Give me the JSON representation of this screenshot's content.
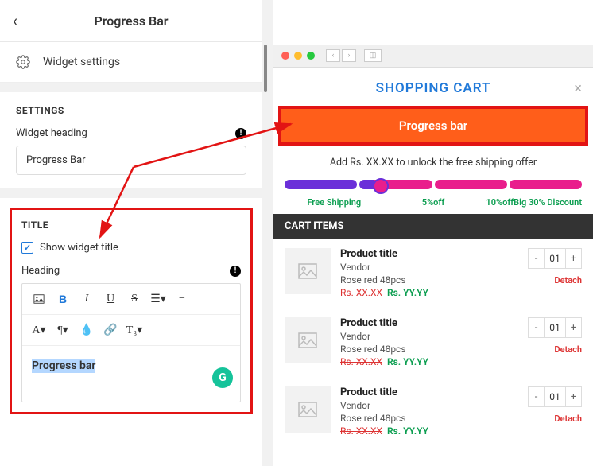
{
  "header": {
    "title": "Progress Bar"
  },
  "widgetSettings": {
    "label": "Widget settings"
  },
  "settings": {
    "section_label": "SETTINGS",
    "heading_label": "Widget heading",
    "heading_value": "Progress Bar"
  },
  "title": {
    "section_label": "TITLE",
    "show_label": "Show widget title",
    "heading_label": "Heading",
    "content": "Progress bar"
  },
  "preview": {
    "cart_title": "SHOPPING CART",
    "banner": "Progress bar",
    "unlock_text": "Add Rs. XX.XX to unlock the free shipping offer",
    "tiers": [
      "Free Shipping",
      "5%off",
      "10%off",
      "Big 30% Discount"
    ],
    "cart_items_label": "CART ITEMS",
    "items": [
      {
        "title": "Product title",
        "vendor": "Vendor",
        "variant": "Rose red 48pcs",
        "old": "Rs. XX.XX",
        "new": "Rs. YY.YY",
        "qty": "01",
        "detach": "Detach"
      },
      {
        "title": "Product title",
        "vendor": "Vendor",
        "variant": "Rose red 48pcs",
        "old": "Rs. XX.XX",
        "new": "Rs. YY.YY",
        "qty": "01",
        "detach": "Detach"
      },
      {
        "title": "Product title",
        "vendor": "Vendor",
        "variant": "Rose red 48pcs",
        "old": "Rs. XX.XX",
        "new": "Rs. YY.YY",
        "qty": "01",
        "detach": "Detach"
      }
    ]
  }
}
